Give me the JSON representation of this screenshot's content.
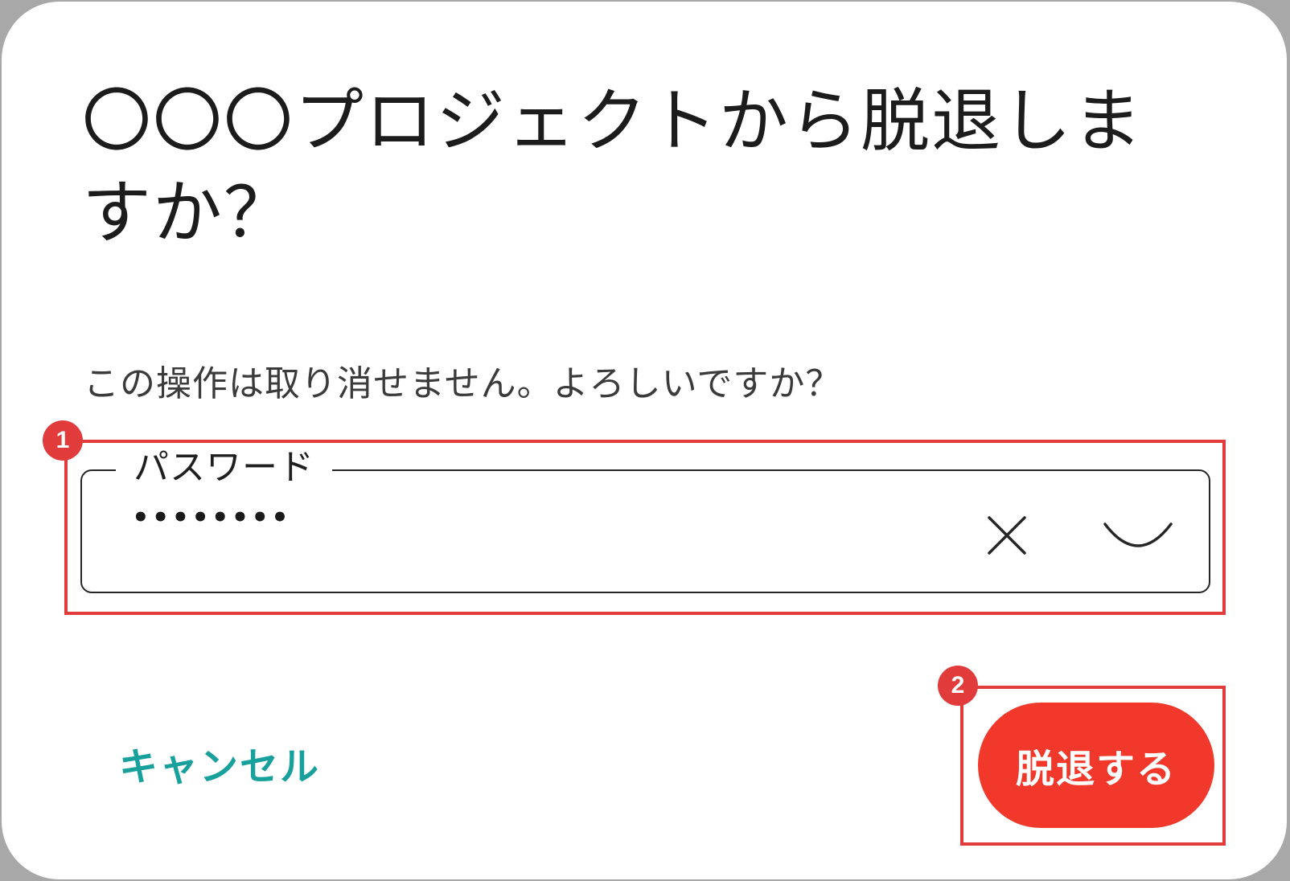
{
  "dialog": {
    "title": "〇〇〇プロジェクトから脱退しますか？",
    "message": "この操作は取り消せません。よろしいですか？"
  },
  "password_field": {
    "label": "パスワード",
    "value": "••••••••",
    "clear_icon": "close-icon",
    "visibility_icon": "eye-closed-icon"
  },
  "actions": {
    "cancel_label": "キャンセル",
    "leave_label": "脱退する"
  },
  "annotations": {
    "step_1": "1",
    "step_2": "2"
  },
  "colors": {
    "accent": "#17a09c",
    "danger": "#f2382b",
    "highlight": "#e23b3b"
  }
}
